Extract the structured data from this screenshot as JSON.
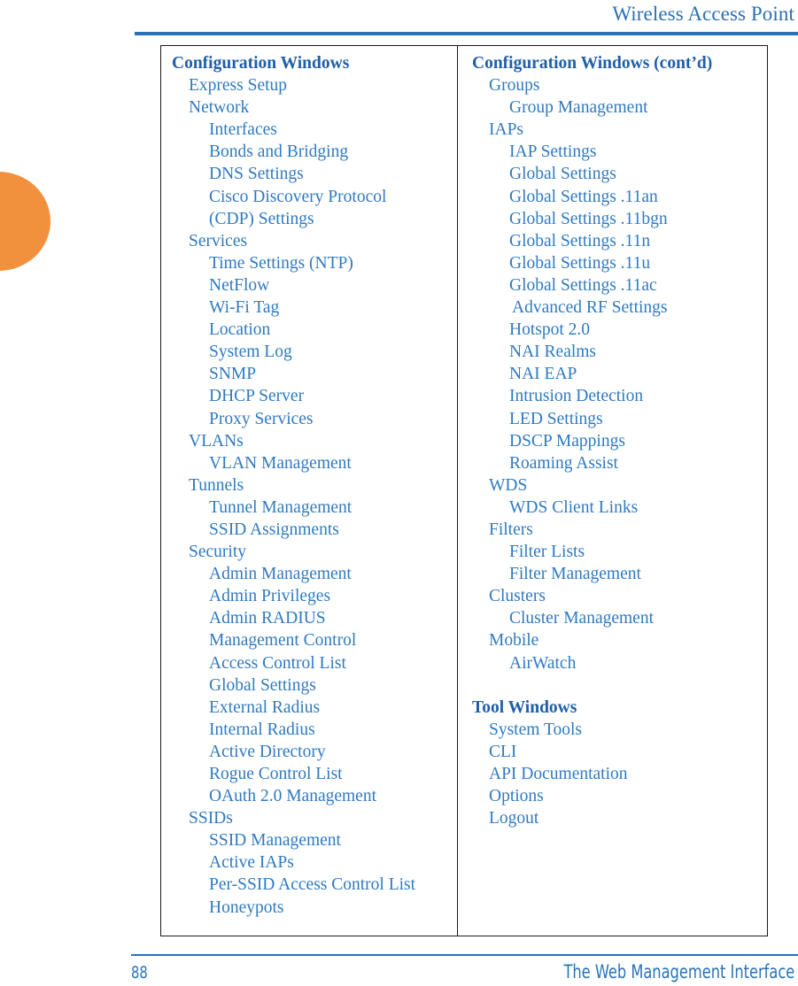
{
  "header": {
    "title": "Wireless Access Point"
  },
  "footer": {
    "page_number": "88",
    "title": "The Web Management Interface"
  },
  "colors": {
    "heading_blue": "#1f5fa8",
    "item_blue": "#2f7ac0",
    "rule_blue": "#2a72b8",
    "tab_orange": "#f2913d",
    "border_black": "#1a1a1a"
  },
  "toc": {
    "left_column": {
      "heading": "Configuration Windows",
      "items": [
        {
          "label": "Express Setup",
          "level": 1
        },
        {
          "label": "Network",
          "level": 1
        },
        {
          "label": "Interfaces",
          "level": 2
        },
        {
          "label": "Bonds and Bridging",
          "level": 2
        },
        {
          "label": "DNS Settings",
          "level": 2
        },
        {
          "label": "Cisco Discovery Protocol",
          "level": 2
        },
        {
          "label": "(CDP) Settings",
          "level": 2
        },
        {
          "label": "Services",
          "level": 1
        },
        {
          "label": "Time Settings (NTP)",
          "level": 2
        },
        {
          "label": "NetFlow",
          "level": 2
        },
        {
          "label": "Wi-Fi Tag",
          "level": 2
        },
        {
          "label": "Location",
          "level": 2
        },
        {
          "label": "System Log",
          "level": 2
        },
        {
          "label": "SNMP",
          "level": 2
        },
        {
          "label": "DHCP Server",
          "level": 2
        },
        {
          "label": "Proxy Services",
          "level": 2
        },
        {
          "label": "VLANs",
          "level": 1
        },
        {
          "label": "VLAN Management",
          "level": 2
        },
        {
          "label": "Tunnels",
          "level": 1
        },
        {
          "label": "Tunnel Management",
          "level": 2
        },
        {
          "label": "SSID Assignments",
          "level": 2
        },
        {
          "label": "Security",
          "level": 1
        },
        {
          "label": "Admin Management",
          "level": 2
        },
        {
          "label": "Admin Privileges",
          "level": 2
        },
        {
          "label": "Admin RADIUS",
          "level": 2
        },
        {
          "label": "Management Control",
          "level": 2
        },
        {
          "label": "Access Control List",
          "level": 2
        },
        {
          "label": "Global Settings",
          "level": 2
        },
        {
          "label": "External Radius",
          "level": 2
        },
        {
          "label": "Internal Radius",
          "level": 2
        },
        {
          "label": "Active Directory",
          "level": 2
        },
        {
          "label": "Rogue Control List",
          "level": 2
        },
        {
          "label": "OAuth 2.0 Management",
          "level": 2
        },
        {
          "label": "SSIDs",
          "level": 1
        },
        {
          "label": "SSID Management",
          "level": 2
        },
        {
          "label": "Active IAPs",
          "level": 2
        },
        {
          "label": "Per-SSID Access Control List",
          "level": 2
        },
        {
          "label": "Honeypots",
          "level": 2
        }
      ]
    },
    "right_column": {
      "heading": "Configuration Windows (cont’d)",
      "items": [
        {
          "label": "Groups",
          "level": 1
        },
        {
          "label": "Group Management",
          "level": 2
        },
        {
          "label": "IAPs",
          "level": 1
        },
        {
          "label": "IAP Settings",
          "level": 2
        },
        {
          "label": "Global Settings",
          "level": 2
        },
        {
          "label": "Global Settings .11an",
          "level": 2
        },
        {
          "label": "Global Settings .11bgn",
          "level": 2
        },
        {
          "label": "Global Settings .11n",
          "level": 2
        },
        {
          "label": "Global Settings .11u",
          "level": 2
        },
        {
          "label": "Global Settings .11ac",
          "level": 2
        },
        {
          "label": "Advanced RF Settings",
          "level": 3
        },
        {
          "label": "Hotspot 2.0",
          "level": 2
        },
        {
          "label": "NAI Realms",
          "level": 2
        },
        {
          "label": "NAI EAP",
          "level": 2
        },
        {
          "label": "Intrusion Detection",
          "level": 2
        },
        {
          "label": "LED Settings",
          "level": 2
        },
        {
          "label": "DSCP Mappings",
          "level": 2
        },
        {
          "label": "Roaming Assist",
          "level": 2
        },
        {
          "label": "WDS",
          "level": 1
        },
        {
          "label": "WDS Client Links",
          "level": 2
        },
        {
          "label": "Filters",
          "level": 1
        },
        {
          "label": "Filter Lists",
          "level": 2
        },
        {
          "label": "Filter Management",
          "level": 2
        },
        {
          "label": "Clusters",
          "level": 1
        },
        {
          "label": "Cluster Management",
          "level": 2
        },
        {
          "label": "Mobile",
          "level": 1
        },
        {
          "label": "AirWatch",
          "level": 2
        }
      ],
      "second_heading": "Tool Windows",
      "second_items": [
        {
          "label": "System Tools",
          "level": 1
        },
        {
          "label": "CLI",
          "level": 1
        },
        {
          "label": "API Documentation",
          "level": 1
        },
        {
          "label": "Options",
          "level": 1
        },
        {
          "label": "Logout",
          "level": 1
        }
      ]
    }
  }
}
